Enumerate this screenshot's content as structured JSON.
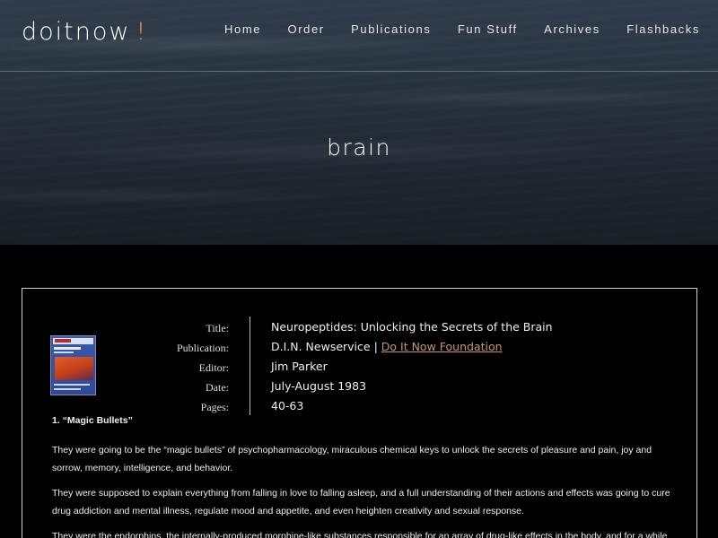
{
  "site": {
    "logo_text": "doitnow",
    "logo_mark": "!"
  },
  "nav": {
    "items": [
      "Home",
      "Order",
      "Publications",
      "Fun Stuff",
      "Archives",
      "Flashbacks"
    ]
  },
  "hero": {
    "title": "brain"
  },
  "publication": {
    "labels": {
      "title": "Title:",
      "publication": "Publication:",
      "editor": "Editor:",
      "date": "Date:",
      "pages": "Pages:"
    },
    "title": "Neuropeptides: Unlocking the Secrets of the Brain",
    "publication_name": "D.I.N. Newservice |",
    "publication_link": "Do It Now Foundation",
    "editor": "Jim Parker",
    "date": "July-August 1983",
    "pages": "40-63"
  },
  "article": {
    "heading": "1. “Magic Bullets”",
    "paragraphs": [
      "They were going to be the “magic bullets” of psychopharmacology, miraculous chemical keys to unlock the secrets of pleasure and pain, joy and sorrow, memory, intelligence, and behavior.",
      "They were supposed to explain everything from falling in love to falling asleep, and a full understanding of their actions and effects was going to cure drug addiction and mental illness, regulate mood and appetite, and even heighten creativity and sexual response.",
      "They were the endorphins, the internally-produced morphine-like substances responsible for an array of drug-like effects in the body, and for a while"
    ]
  },
  "colors": {
    "accent": "#e0a060",
    "link": "#c8956a",
    "background": "#000000"
  }
}
